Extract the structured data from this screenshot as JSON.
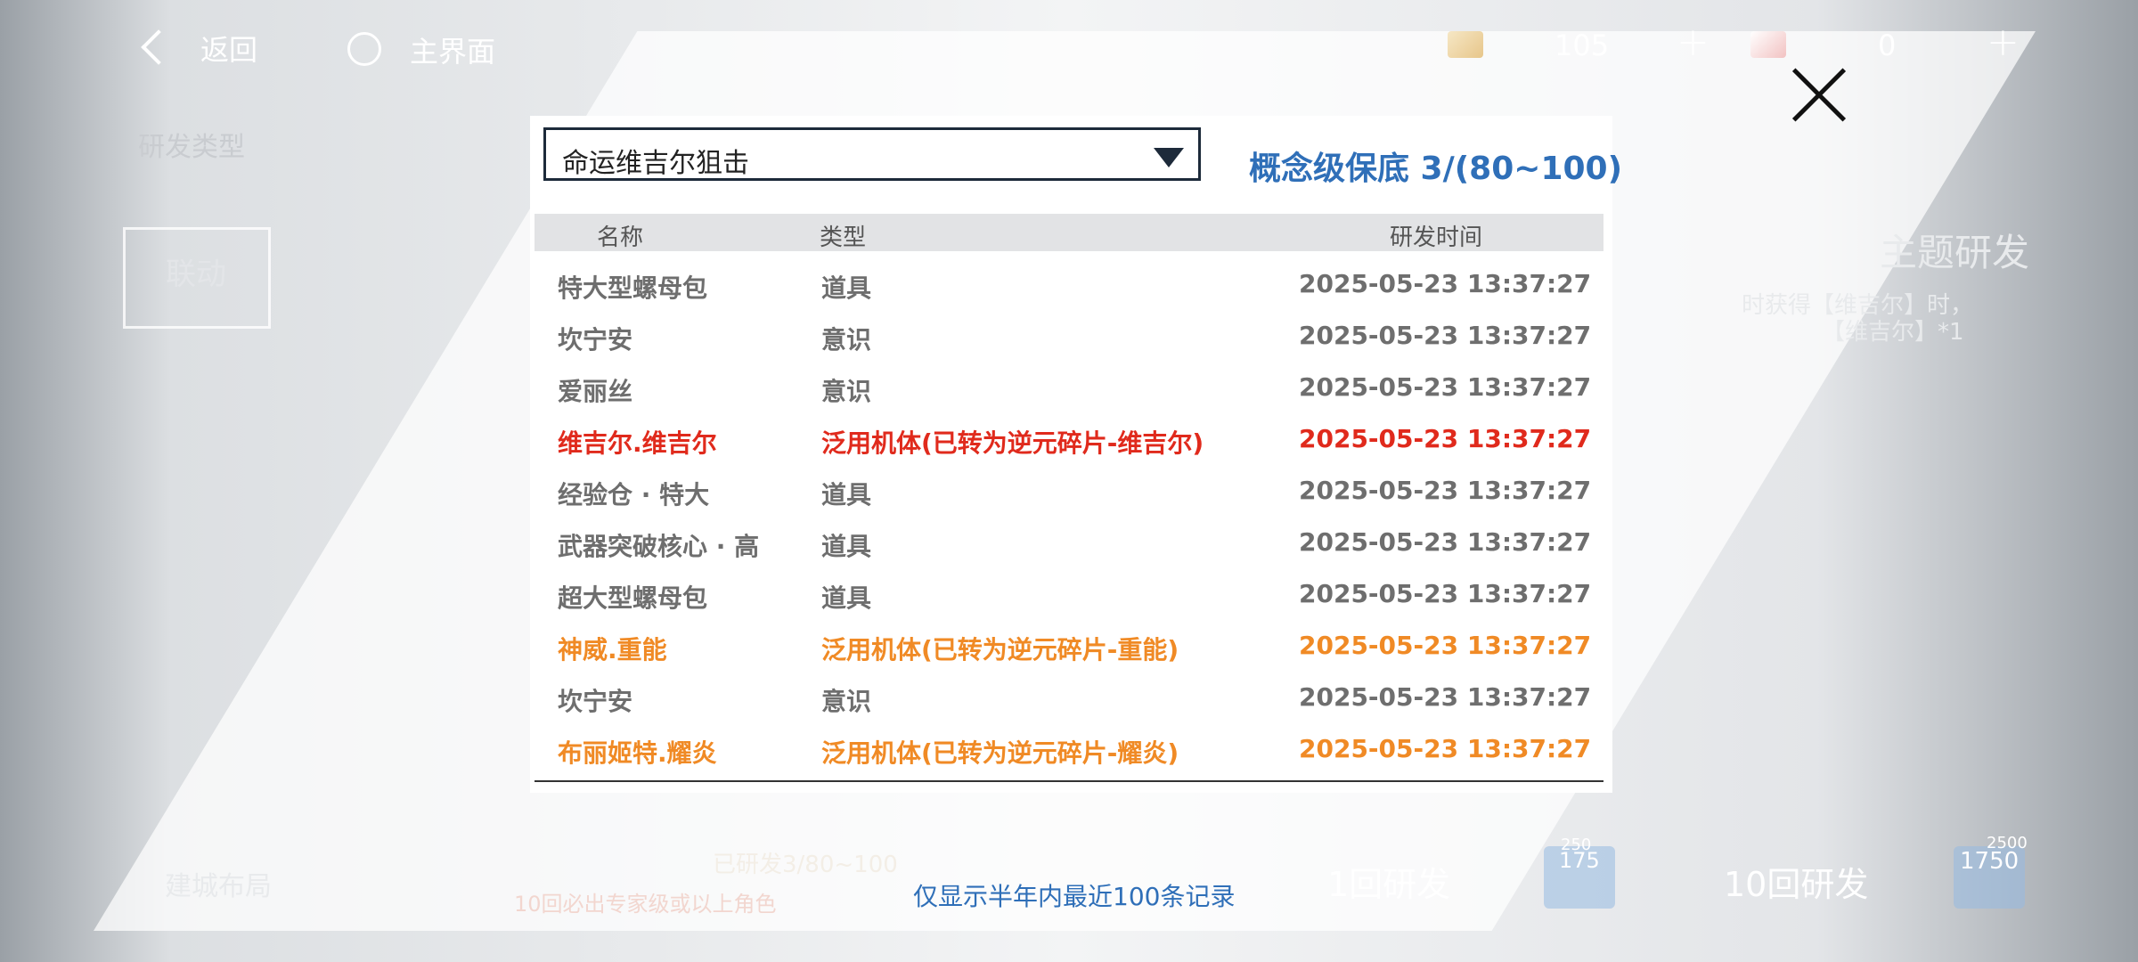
{
  "topbar": {
    "back_label": "返回",
    "home_label": "主界面",
    "resource1_value": "105",
    "resource2_value": "0"
  },
  "background": {
    "research_type": "研发类型",
    "theme_title": "主题研发",
    "theme_desc_1": "时获得【维吉尔】时，",
    "theme_desc_2": "【维吉尔】*1",
    "badge_left": "联动",
    "bottom_left": "建城布局",
    "concept_progress": "已研发3/80~100",
    "guarantee_text": "10回必出专家级或以上角色",
    "single_draw": "1回研发",
    "single_cost": "175",
    "ten_draw": "10回研发",
    "ten_cost": "1750",
    "ten_cost_original": "2500",
    "single_cost_original": "250"
  },
  "dialog": {
    "dropdown_selected": "命运维吉尔狙击",
    "pity_text": "概念级保底 3/(80~100)",
    "columns": {
      "name": "名称",
      "type": "类型",
      "time": "研发时间"
    },
    "records": [
      {
        "name": "特大型螺母包",
        "type": "道具",
        "time": "2025-05-23 13:37:27",
        "tone": "gray"
      },
      {
        "name": "坎宁安",
        "type": "意识",
        "time": "2025-05-23 13:37:27",
        "tone": "gray"
      },
      {
        "name": "爱丽丝",
        "type": "意识",
        "time": "2025-05-23 13:37:27",
        "tone": "gray"
      },
      {
        "name": "维吉尔.维吉尔",
        "type": "泛用机体(已转为逆元碎片-维吉尔)",
        "time": "2025-05-23 13:37:27",
        "tone": "red"
      },
      {
        "name": "经验仓 · 特大",
        "type": "道具",
        "time": "2025-05-23 13:37:27",
        "tone": "gray"
      },
      {
        "name": "武器突破核心 · 高",
        "type": "道具",
        "time": "2025-05-23 13:37:27",
        "tone": "gray"
      },
      {
        "name": "超大型螺母包",
        "type": "道具",
        "time": "2025-05-23 13:37:27",
        "tone": "gray"
      },
      {
        "name": "神威.重能",
        "type": "泛用机体(已转为逆元碎片-重能)",
        "time": "2025-05-23 13:37:27",
        "tone": "orange"
      },
      {
        "name": "坎宁安",
        "type": "意识",
        "time": "2025-05-23 13:37:27",
        "tone": "gray"
      },
      {
        "name": "布丽姬特.耀炎",
        "type": "泛用机体(已转为逆元碎片-耀炎)",
        "time": "2025-05-23 13:37:27",
        "tone": "orange"
      }
    ],
    "footer_note": "仅显示半年内最近100条记录"
  },
  "colors": {
    "accent_blue": "#2f6fb8",
    "record_red": "#e02a1c",
    "record_orange": "#f08a25",
    "record_gray": "#6e6e6e"
  }
}
